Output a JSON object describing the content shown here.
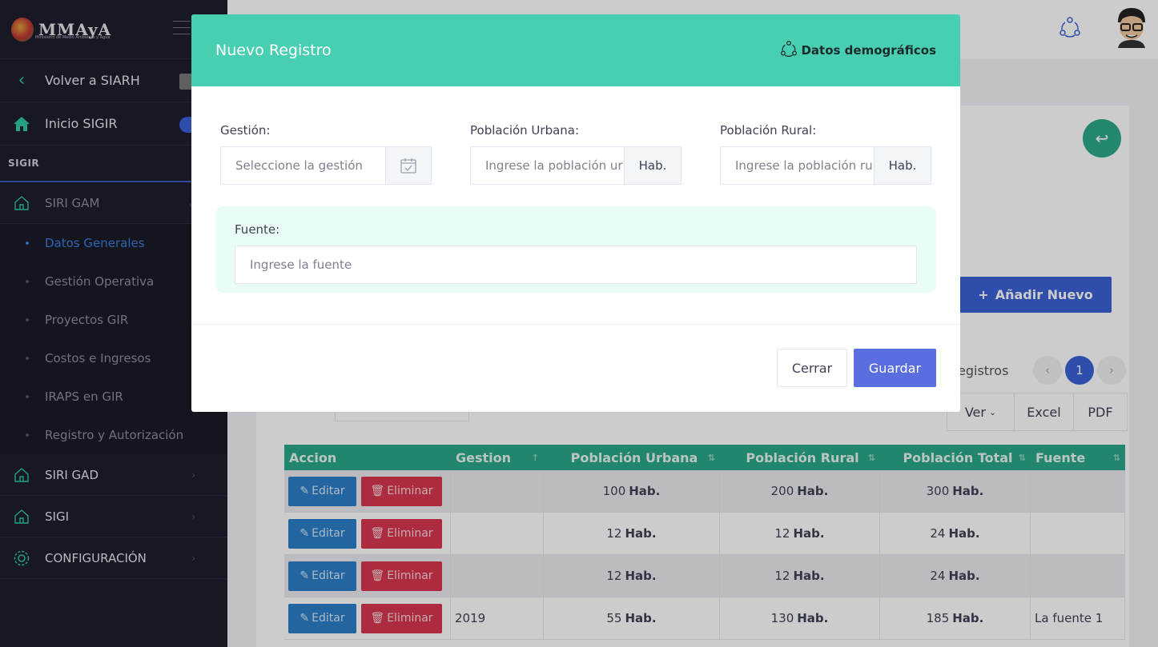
{
  "app": {
    "logo_text": "MMAyA",
    "logo_subtitle": "Ministerio de Medio Ambiente y Agua"
  },
  "sidebar": {
    "back_label": "Volver a SIARH",
    "home_label": "Inicio SIGIR",
    "section_label": "SIGIR",
    "groups": [
      {
        "label": "SIRI GAM",
        "icon": "home-icon"
      },
      {
        "label": "SIRI GAD",
        "icon": "home-icon"
      },
      {
        "label": "SIGI",
        "icon": "home-icon"
      },
      {
        "label": "CONFIGURACIÓN",
        "icon": "gear-icon"
      }
    ],
    "sub_items": [
      {
        "label": "Datos Generales",
        "active": true
      },
      {
        "label": "Gestión Operativa"
      },
      {
        "label": "Proyectos GIR"
      },
      {
        "label": "Costos e Ingresos"
      },
      {
        "label": "IRAPS en GIR"
      },
      {
        "label": "Registro y Autorización"
      }
    ]
  },
  "main": {
    "add_button": "Añadir Nuevo",
    "registros_label": "egistros",
    "current_page": "1",
    "export": {
      "ver": "Ver",
      "excel": "Excel",
      "pdf": "PDF"
    },
    "table": {
      "headers": [
        "Accion",
        "Gestion",
        "Población Urbana",
        "Población Rural",
        "Población Total",
        "Fuente"
      ],
      "edit_label": "Editar",
      "delete_label": "Eliminar",
      "unit": "Hab.",
      "rows": [
        {
          "gestion": "",
          "urbana": "100",
          "rural": "200",
          "total": "300",
          "fuente": ""
        },
        {
          "gestion": "",
          "urbana": "12",
          "rural": "12",
          "total": "24",
          "fuente": ""
        },
        {
          "gestion": "",
          "urbana": "12",
          "rural": "12",
          "total": "24",
          "fuente": ""
        },
        {
          "gestion": "2019",
          "urbana": "55",
          "rural": "130",
          "total": "185",
          "fuente": "La fuente 1"
        }
      ]
    }
  },
  "modal": {
    "title": "Nuevo Registro",
    "badge": "Datos demográficos",
    "gestion_label": "Gestión:",
    "gestion_placeholder": "Seleccione la gestión",
    "urbana_label": "Población Urbana:",
    "urbana_placeholder": "Ingrese la población ur",
    "rural_label": "Población Rural:",
    "rural_placeholder": "Ingrese la población ru",
    "unit_addon": "Hab.",
    "fuente_label": "Fuente:",
    "fuente_placeholder": "Ingrese la fuente",
    "close_button": "Cerrar",
    "save_button": "Guardar"
  },
  "colors": {
    "modal_header": "#48cfb2",
    "primary": "#3b62d8",
    "save": "#5a6ee0",
    "edit": "#2c7fc9",
    "delete": "#d9364f",
    "table_header": "#2aa889",
    "sidebar": "#1e1e2d"
  }
}
